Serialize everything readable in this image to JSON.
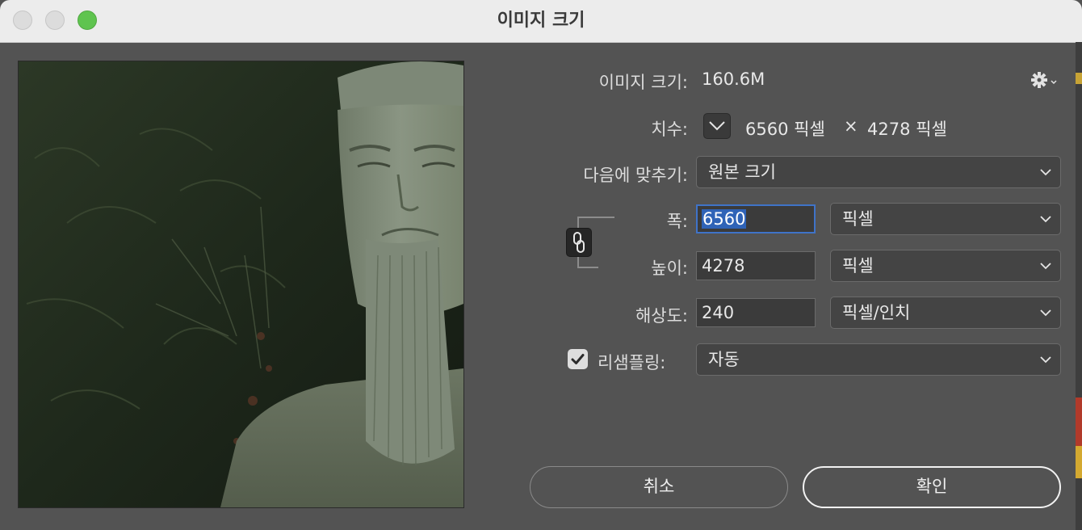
{
  "window": {
    "title": "이미지 크기"
  },
  "image_size": {
    "label": "이미지 크기:",
    "value": "160.6M"
  },
  "dimensions": {
    "label": "치수:",
    "width": "6560 픽셀",
    "times": "×",
    "height": "4278 픽셀"
  },
  "fit_to": {
    "label": "다음에 맞추기:",
    "value": "원본 크기"
  },
  "width": {
    "label": "폭:",
    "value": "6560",
    "unit": "픽셀"
  },
  "height": {
    "label": "높이:",
    "value": "4278",
    "unit": "픽셀"
  },
  "resolution": {
    "label": "해상도:",
    "value": "240",
    "unit": "픽셀/인치"
  },
  "resample": {
    "label": "리샘플링:",
    "value": "자동",
    "checked": true
  },
  "buttons": {
    "cancel": "취소",
    "ok": "확인"
  },
  "icons": {
    "settings": "gear-icon",
    "constrain": "chain-link-icon",
    "toggle": "chevron-down-icon"
  },
  "colors": {
    "focus": "#3f73c8",
    "dialog_bg": "#535353",
    "zoom": "#5fc44f"
  }
}
